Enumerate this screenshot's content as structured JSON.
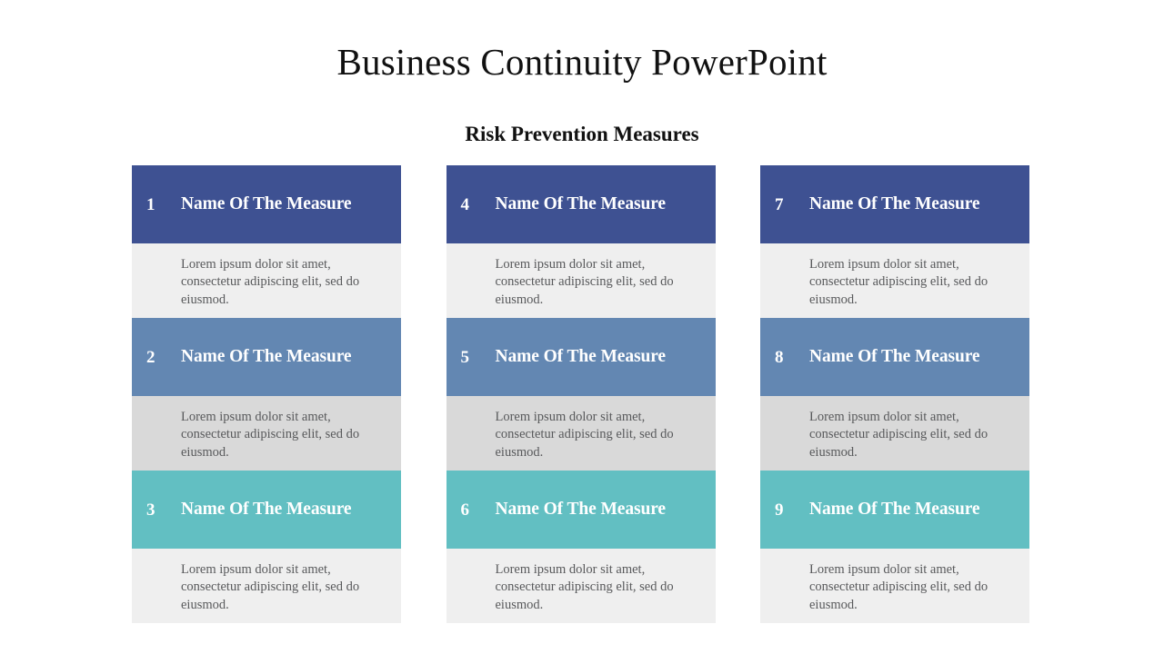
{
  "slide": {
    "title": "Business Continuity PowerPoint",
    "subtitle": "Risk Prevention Measures"
  },
  "palette": {
    "header_dark_blue": "#3E5192",
    "header_medium_blue": "#6387B2",
    "header_teal": "#62BFC2",
    "body_light_grey": "#EFEFEF",
    "body_dark_grey": "#D9D9D9",
    "header_text": "#FFFFFF",
    "body_text": "#58595B",
    "slide_background": "#FFFFFF",
    "title_text": "#111111"
  },
  "columns": [
    {
      "cards": [
        {
          "number": "1",
          "title": "Name Of The Measure",
          "body": "Lorem ipsum dolor sit amet, consectetur adipiscing elit, sed do eiusmod.",
          "header_color": "#3E5192",
          "body_color": "#EFEFEF"
        },
        {
          "number": "2",
          "title": "Name Of The Measure",
          "body": "Lorem ipsum dolor sit amet, consectetur adipiscing elit, sed do eiusmod.",
          "header_color": "#6387B2",
          "body_color": "#D9D9D9"
        },
        {
          "number": "3",
          "title": "Name Of The Measure",
          "body": "Lorem ipsum dolor sit amet, consectetur adipiscing elit, sed do eiusmod.",
          "header_color": "#62BFC2",
          "body_color": "#EFEFEF"
        }
      ]
    },
    {
      "cards": [
        {
          "number": "4",
          "title": "Name Of The Measure",
          "body": "Lorem ipsum dolor sit amet, consectetur adipiscing elit, sed do eiusmod.",
          "header_color": "#3E5192",
          "body_color": "#EFEFEF"
        },
        {
          "number": "5",
          "title": "Name Of The Measure",
          "body": "Lorem ipsum dolor sit amet, consectetur adipiscing elit, sed do eiusmod.",
          "header_color": "#6387B2",
          "body_color": "#D9D9D9"
        },
        {
          "number": "6",
          "title": "Name Of The Measure",
          "body": "Lorem ipsum dolor sit amet, consectetur adipiscing elit, sed do eiusmod.",
          "header_color": "#62BFC2",
          "body_color": "#EFEFEF"
        }
      ]
    },
    {
      "cards": [
        {
          "number": "7",
          "title": "Name Of The Measure",
          "body": "Lorem ipsum dolor sit amet, consectetur adipiscing elit, sed do eiusmod.",
          "header_color": "#3E5192",
          "body_color": "#EFEFEF"
        },
        {
          "number": "8",
          "title": "Name Of The Measure",
          "body": "Lorem ipsum dolor sit amet, consectetur adipiscing elit, sed do eiusmod.",
          "header_color": "#6387B2",
          "body_color": "#D9D9D9"
        },
        {
          "number": "9",
          "title": "Name Of The Measure",
          "body": "Lorem ipsum dolor sit amet, consectetur adipiscing elit, sed do eiusmod.",
          "header_color": "#62BFC2",
          "body_color": "#EFEFEF"
        }
      ]
    }
  ]
}
